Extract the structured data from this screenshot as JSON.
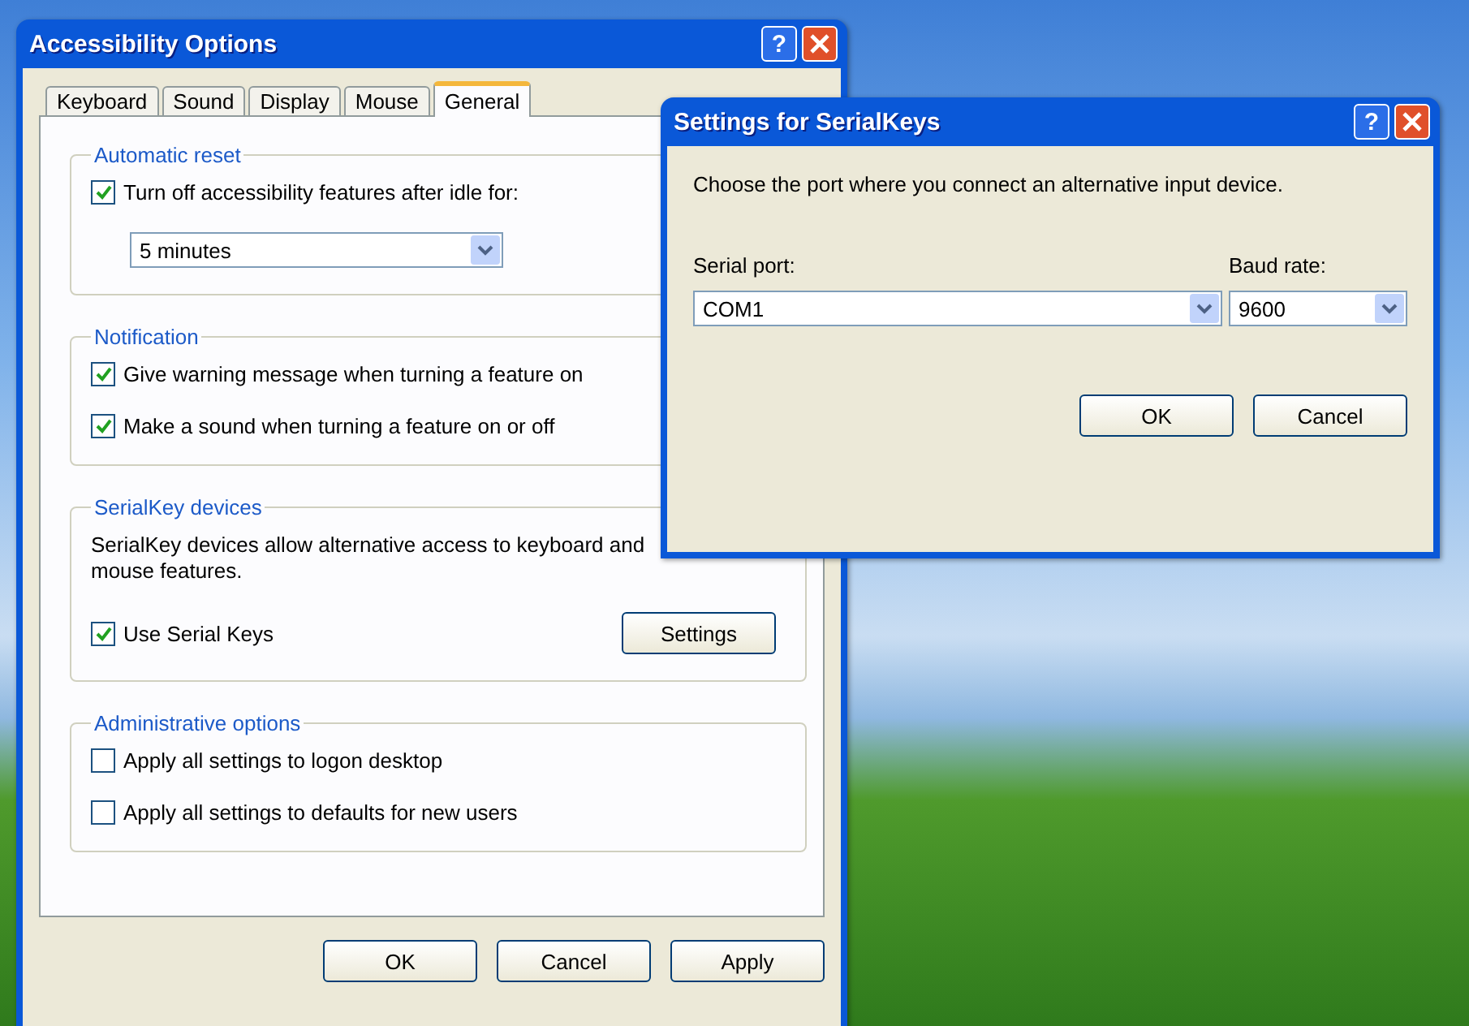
{
  "main_window": {
    "title": "Accessibility Options",
    "help": "?",
    "tabs": [
      {
        "label": "Keyboard",
        "selected": false
      },
      {
        "label": "Sound",
        "selected": false
      },
      {
        "label": "Display",
        "selected": false
      },
      {
        "label": "Mouse",
        "selected": false
      },
      {
        "label": "General",
        "selected": true
      }
    ],
    "groups": [
      {
        "title": "Automatic reset",
        "items": [
          {
            "kind": "checkbox",
            "label": "Turn off accessibility features after idle for:",
            "checked": true
          },
          {
            "kind": "dropdown",
            "value": "5 minutes"
          }
        ]
      },
      {
        "title": "Notification",
        "items": [
          {
            "kind": "checkbox",
            "label": "Give warning message when turning a feature on",
            "checked": true
          },
          {
            "kind": "checkbox",
            "label": "Make a sound when turning a feature on or off",
            "checked": true
          }
        ]
      },
      {
        "title": "SerialKey devices",
        "items": [
          {
            "kind": "text",
            "text": "SerialKey devices allow alternative access to keyboard and mouse features."
          },
          {
            "kind": "checkbox",
            "label": "Use Serial Keys",
            "checked": true,
            "button": "Settings"
          }
        ]
      },
      {
        "title": "Administrative options",
        "items": [
          {
            "kind": "checkbox",
            "label": "Apply all settings to logon desktop",
            "checked": false
          },
          {
            "kind": "checkbox",
            "label": "Apply all settings to defaults for new users",
            "checked": false
          }
        ]
      }
    ],
    "buttons": [
      "OK",
      "Cancel",
      "Apply"
    ]
  },
  "serialkeys_window": {
    "title": "Settings for SerialKeys",
    "help": "?",
    "instruction": "Choose the port where you connect an alternative input device.",
    "serial_port": {
      "label": "Serial port:",
      "value": "COM1"
    },
    "baud_rate": {
      "label": "Baud rate:",
      "value": "9600"
    },
    "buttons": [
      "OK",
      "Cancel"
    ]
  }
}
